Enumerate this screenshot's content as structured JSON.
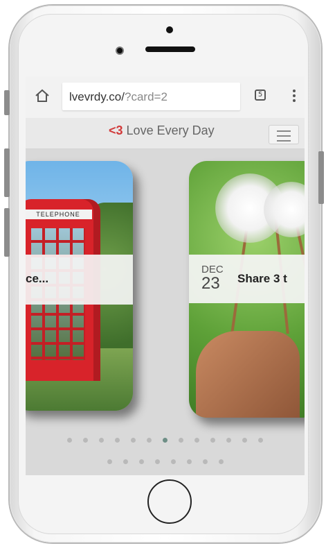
{
  "browser": {
    "url_host": "lvevrdy.co/",
    "url_path": "?card=2",
    "tab_count": "5"
  },
  "app": {
    "heart": "<3",
    "title": "Love Every Day"
  },
  "cards": [
    {
      "caption": "ce...",
      "sign": "TELEPHONE"
    },
    {
      "month": "DEC",
      "day": "23",
      "caption": "Share 3 t"
    }
  ],
  "pager": {
    "row1_count": 13,
    "row2_count": 8,
    "active_index": 6
  },
  "icons": [
    "home-icon",
    "tabs-icon",
    "more-vert-icon",
    "hamburger-icon"
  ]
}
